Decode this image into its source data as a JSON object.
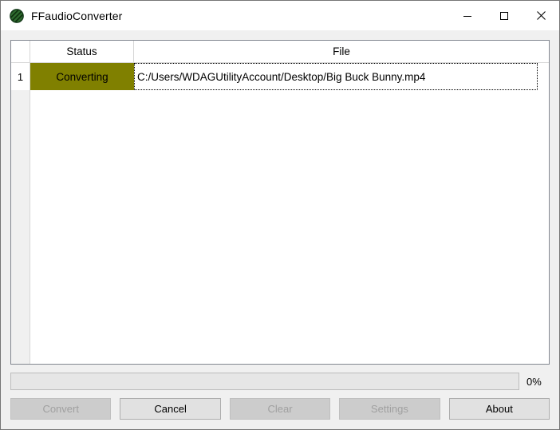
{
  "window": {
    "title": "FFaudioConverter",
    "icon": "app-logo-icon",
    "controls": {
      "minimize": "minimize-icon",
      "maximize": "maximize-icon",
      "close": "close-icon"
    }
  },
  "table": {
    "columns": [
      {
        "key": "status",
        "label": "Status"
      },
      {
        "key": "file",
        "label": "File"
      }
    ],
    "rows": [
      {
        "number": "1",
        "status": "Converting",
        "status_color": "#808000",
        "file": "C:/Users/WDAGUtilityAccount/Desktop/Big Buck Bunny.mp4"
      }
    ]
  },
  "progress": {
    "percent": 0,
    "label": "0%"
  },
  "buttons": [
    {
      "name": "convert",
      "label": "Convert",
      "enabled": false
    },
    {
      "name": "cancel",
      "label": "Cancel",
      "enabled": true
    },
    {
      "name": "clear",
      "label": "Clear",
      "enabled": false
    },
    {
      "name": "settings",
      "label": "Settings",
      "enabled": false
    },
    {
      "name": "about",
      "label": "About",
      "enabled": true
    }
  ]
}
